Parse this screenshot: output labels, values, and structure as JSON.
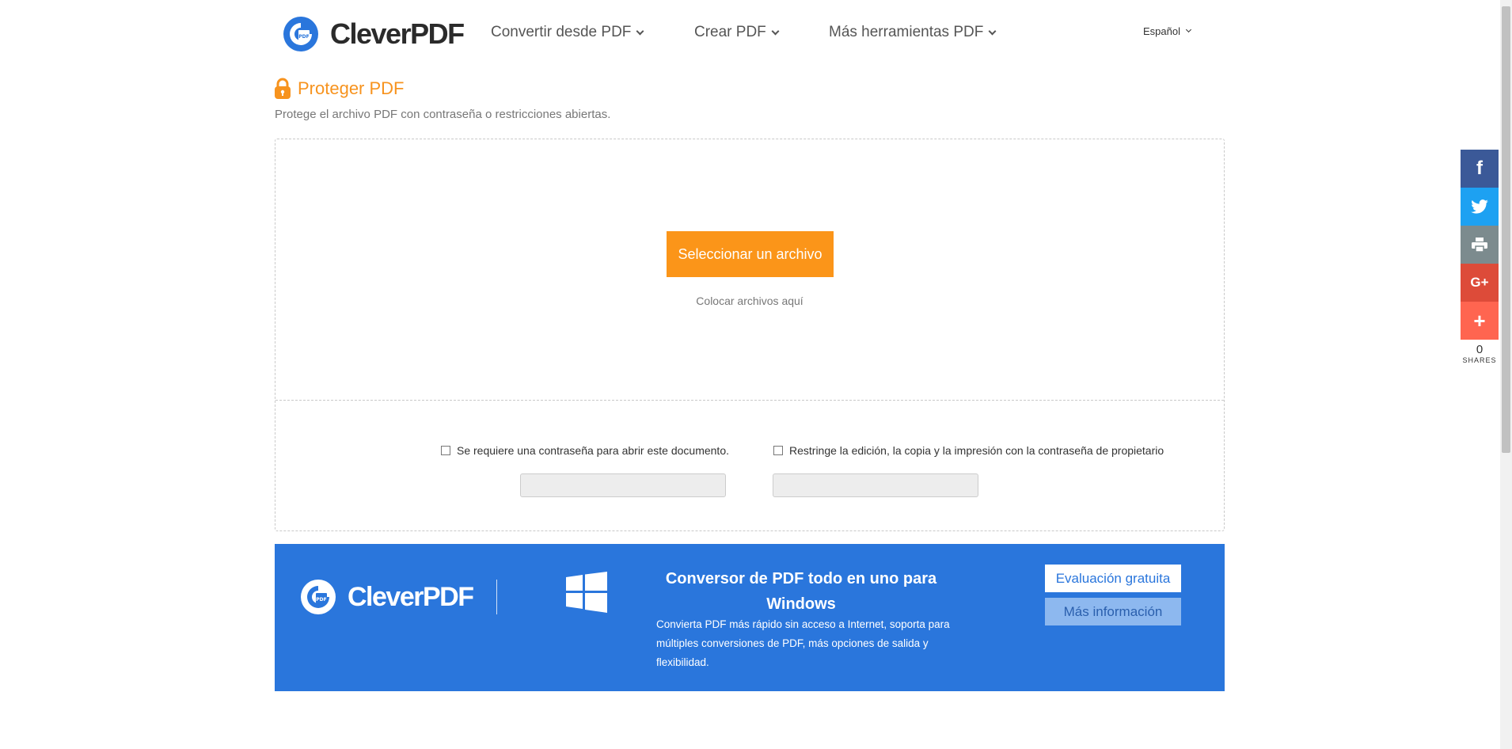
{
  "header": {
    "logo_text": "CleverPDF",
    "nav": [
      {
        "label": "Convertir desde PDF"
      },
      {
        "label": "Crear PDF"
      },
      {
        "label": "Más herramientas PDF"
      }
    ],
    "language": "Español"
  },
  "page": {
    "title": "Proteger PDF",
    "subtitle": "Protege el archivo PDF con contraseña o restricciones abiertas."
  },
  "upload": {
    "select_label": "Seleccionar un archivo",
    "drop_hint": "Colocar archivos aquí"
  },
  "options": {
    "open_password_label": "Se requiere una contraseña para abrir este documento.",
    "open_password_checked": false,
    "open_password_value": "",
    "owner_password_label": "Restringe la edición, la copia y la impresión con la contraseña de propietario",
    "owner_password_checked": false,
    "owner_password_value": ""
  },
  "banner": {
    "logo_text": "CleverPDF",
    "title": "Conversor de PDF todo en uno para Windows",
    "description": "Convierta PDF más rápido sin acceso a Internet, soporta para múltiples conversiones de PDF, más opciones de salida y flexibilidad.",
    "trial_label": "Evaluación gratuita",
    "info_label": "Más información"
  },
  "social": {
    "buttons": [
      {
        "name": "facebook",
        "glyph": "f",
        "color": "#3b5998"
      },
      {
        "name": "twitter",
        "color": "#1da1f2"
      },
      {
        "name": "print",
        "color": "#7c8b8e"
      },
      {
        "name": "google-plus",
        "glyph": "G+",
        "color": "#dd4b39"
      },
      {
        "name": "more",
        "glyph": "+",
        "color": "#ff6550"
      }
    ],
    "share_count": "0",
    "share_label": "SHARES"
  },
  "colors": {
    "accent_orange": "#fb9519",
    "brand_blue": "#2a76dc",
    "title_orange": "#f7931e"
  }
}
